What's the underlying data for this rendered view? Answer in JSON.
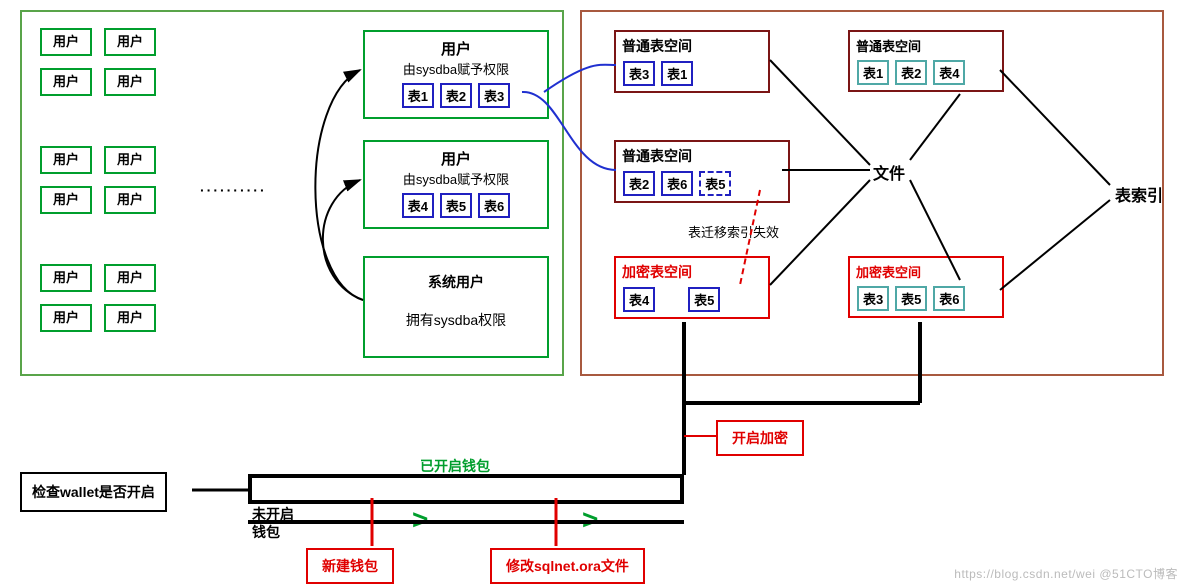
{
  "left": {
    "userLabel": "用户",
    "dots": "··········",
    "userGrid": [
      [
        "用户",
        "用户"
      ],
      [
        "用户",
        "用户"
      ],
      [
        "用户",
        "用户"
      ],
      [
        "用户",
        "用户"
      ],
      [
        "用户",
        "用户"
      ],
      [
        "用户",
        "用户"
      ]
    ]
  },
  "middle": {
    "block1": {
      "title": "用户",
      "sub": "由sysdba赋予权限",
      "tables": [
        "表1",
        "表2",
        "表3"
      ]
    },
    "block2": {
      "title": "用户",
      "sub": "由sysdba赋予权限",
      "tables": [
        "表4",
        "表5",
        "表6"
      ]
    },
    "sysblock": {
      "line1": "系统用户",
      "line2": "拥有sysdba权限"
    }
  },
  "right1": {
    "ts1": {
      "title": "普通表空间",
      "tables": [
        "表3",
        "表1"
      ]
    },
    "ts2": {
      "title": "普通表空间",
      "tables": [
        "表2",
        "表6"
      ],
      "dashed": "表5"
    },
    "ts3": {
      "title": "加密表空间",
      "tables": [
        "表4",
        "表5"
      ]
    },
    "migrationNote": "表迁移索引失效",
    "fileLabel": "文件"
  },
  "right2": {
    "ts1": {
      "title": "普通表空间",
      "tables": [
        "表1",
        "表2",
        "表4"
      ]
    },
    "ts2": {
      "title": "加密表空间",
      "tables": [
        "表3",
        "表5",
        "表6"
      ]
    },
    "indexLabel": "表索引"
  },
  "bottom": {
    "checkWallet": "检查wallet是否开启",
    "opened": "已开启钱包",
    "notOpened": "未开启",
    "walletWord": "钱包",
    "newWallet": "新建钱包",
    "modifySqlnet": "修改sqlnet.ora文件",
    "enableEnc": "开启加密"
  },
  "watermark": "https://blog.csdn.net/wei @51CTO博客"
}
